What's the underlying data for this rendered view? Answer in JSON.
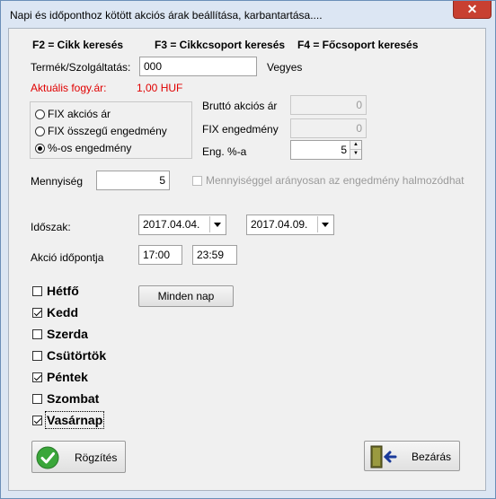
{
  "window": {
    "title": "Napi és időponthoz kötött akciós árak beállítása, karbantartása....",
    "close_label": "✕"
  },
  "hotkeys": {
    "f2": "F2 = Cikk keresés",
    "f3": "F3 = Cikkcsoport keresés",
    "f4": "F4 = Főcsoport keresés"
  },
  "product": {
    "label": "Termék/Szolgáltatás:",
    "value": "000",
    "name": "Vegyes"
  },
  "current_price": {
    "label": "Aktuális fogy.ár:",
    "value": "1,00 HUF",
    "color": "#e00000"
  },
  "discount_type": {
    "options": [
      {
        "label": "FIX akciós ár",
        "selected": false
      },
      {
        "label": "FIX összegű engedmény",
        "selected": false
      },
      {
        "label": "%-os engedmény",
        "selected": true
      }
    ]
  },
  "gross_price": {
    "label": "Bruttó akciós ár",
    "value": "0"
  },
  "fix_discount": {
    "label": "FIX engedmény",
    "value": "0"
  },
  "percent": {
    "label": "Eng. %-a",
    "value": "5"
  },
  "quantity": {
    "label": "Mennyiség",
    "value": "5",
    "proportional_label": "Mennyiséggel arányosan az engedmény halmozódhat",
    "proportional_checked": false
  },
  "period": {
    "label": "Időszak:",
    "from": "2017.04.04.",
    "to": "2017.04.09."
  },
  "time": {
    "label": "Akció időpontja",
    "from": "17:00",
    "to": "23:59"
  },
  "days": [
    {
      "label": "Hétfő",
      "checked": false
    },
    {
      "label": "Kedd",
      "checked": true
    },
    {
      "label": "Szerda",
      "checked": false
    },
    {
      "label": "Csütörtök",
      "checked": false
    },
    {
      "label": "Péntek",
      "checked": true
    },
    {
      "label": "Szombat",
      "checked": false
    },
    {
      "label": "Vasárnap",
      "checked": true
    }
  ],
  "buttons": {
    "every_day": "Minden nap",
    "save": "Rögzítés",
    "close": "Bezárás"
  }
}
